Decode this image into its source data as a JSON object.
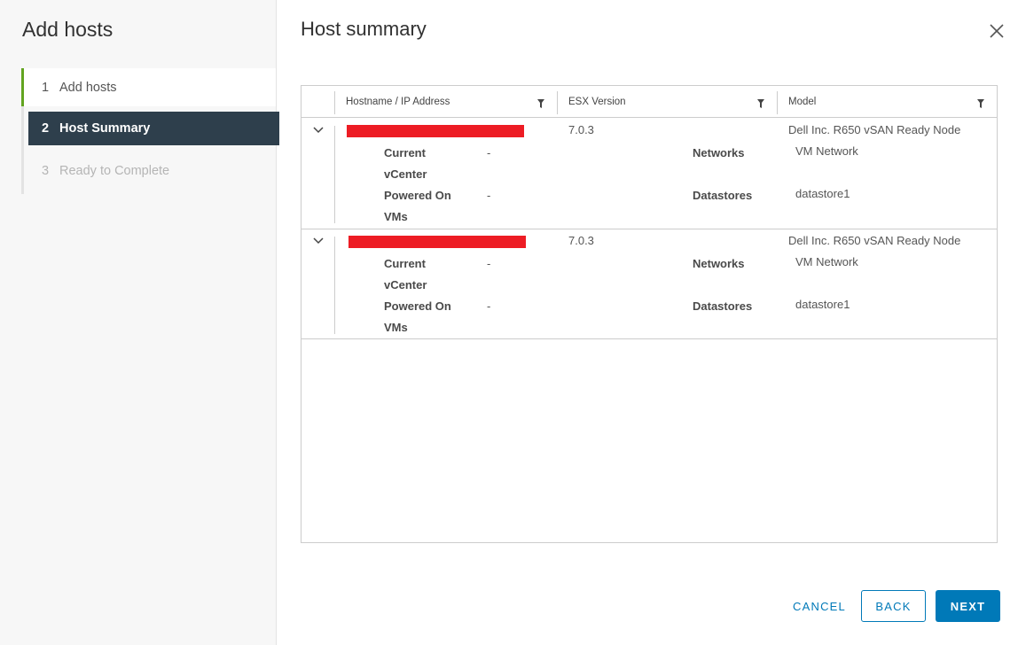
{
  "nav": {
    "title": "Add hosts",
    "steps": [
      {
        "num": "1",
        "label": "Add hosts"
      },
      {
        "num": "2",
        "label": "Host Summary"
      },
      {
        "num": "3",
        "label": "Ready to Complete"
      }
    ]
  },
  "main": {
    "title": "Host summary",
    "columns": [
      "Hostname / IP Address",
      "ESX Version",
      "Model"
    ],
    "labels": {
      "current_vcenter_1": "Current",
      "current_vcenter_2": "vCenter",
      "powered_on_1": "Powered On",
      "powered_on_2": "VMs",
      "networks": "Networks",
      "datastores": "Datastores"
    },
    "rows": [
      {
        "esx_version": "7.0.3",
        "model": "Dell Inc. R650 vSAN Ready Node",
        "current_vcenter": "-",
        "powered_on_vms": "-",
        "networks": "VM Network",
        "datastores": "datastore1"
      },
      {
        "esx_version": "7.0.3",
        "model": "Dell Inc. R650 vSAN Ready Node",
        "current_vcenter": "-",
        "powered_on_vms": "-",
        "networks": "VM Network",
        "datastores": "datastore1"
      }
    ]
  },
  "footer": {
    "cancel": "CANCEL",
    "back": "BACK",
    "next": "NEXT"
  },
  "colors": {
    "accent": "#0079b8",
    "active_step_bg": "#2e3f4c",
    "completed_step": "#62a420",
    "redaction": "#ed1c24"
  }
}
